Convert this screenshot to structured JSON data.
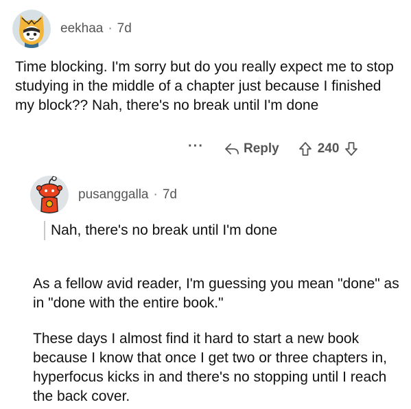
{
  "parent_comment": {
    "username": "eekhaa",
    "separator": "·",
    "age": "7d",
    "body": "Time blocking. I'm sorry but do you really expect me to stop studying in the middle of a chapter just because I finished my block?? Nah, there's no break until I'm done",
    "actions": {
      "more_label": "···",
      "reply_label": "Reply",
      "score": "240"
    }
  },
  "reply_comment": {
    "username": "pusanggalla",
    "separator": "·",
    "age": "7d",
    "quote": "Nah, there's no break until I'm done",
    "paragraphs": [
      "As a fellow avid reader, I'm guessing you mean \"done\" as in \"done with the entire book.\"",
      "These days I almost find it hard to start a new book because I know that once I get two or three chapters in, hyperfocus kicks in and there's no stopping until I reach the back cover."
    ]
  },
  "colors": {
    "avatar1_bg": "#d7e0e4",
    "avatar1_accent": "#f2b53a",
    "avatar2_bg": "#dfe3e6",
    "avatar2_accent": "#e8421e",
    "meta_text": "#555555",
    "body_text": "#111111"
  },
  "icons": {
    "avatar1": "cat-hood-avatar",
    "avatar2": "red-snoo-avatar",
    "reply": "reply-arrow-icon",
    "upvote": "upvote-arrow-icon",
    "downvote": "downvote-arrow-icon"
  }
}
